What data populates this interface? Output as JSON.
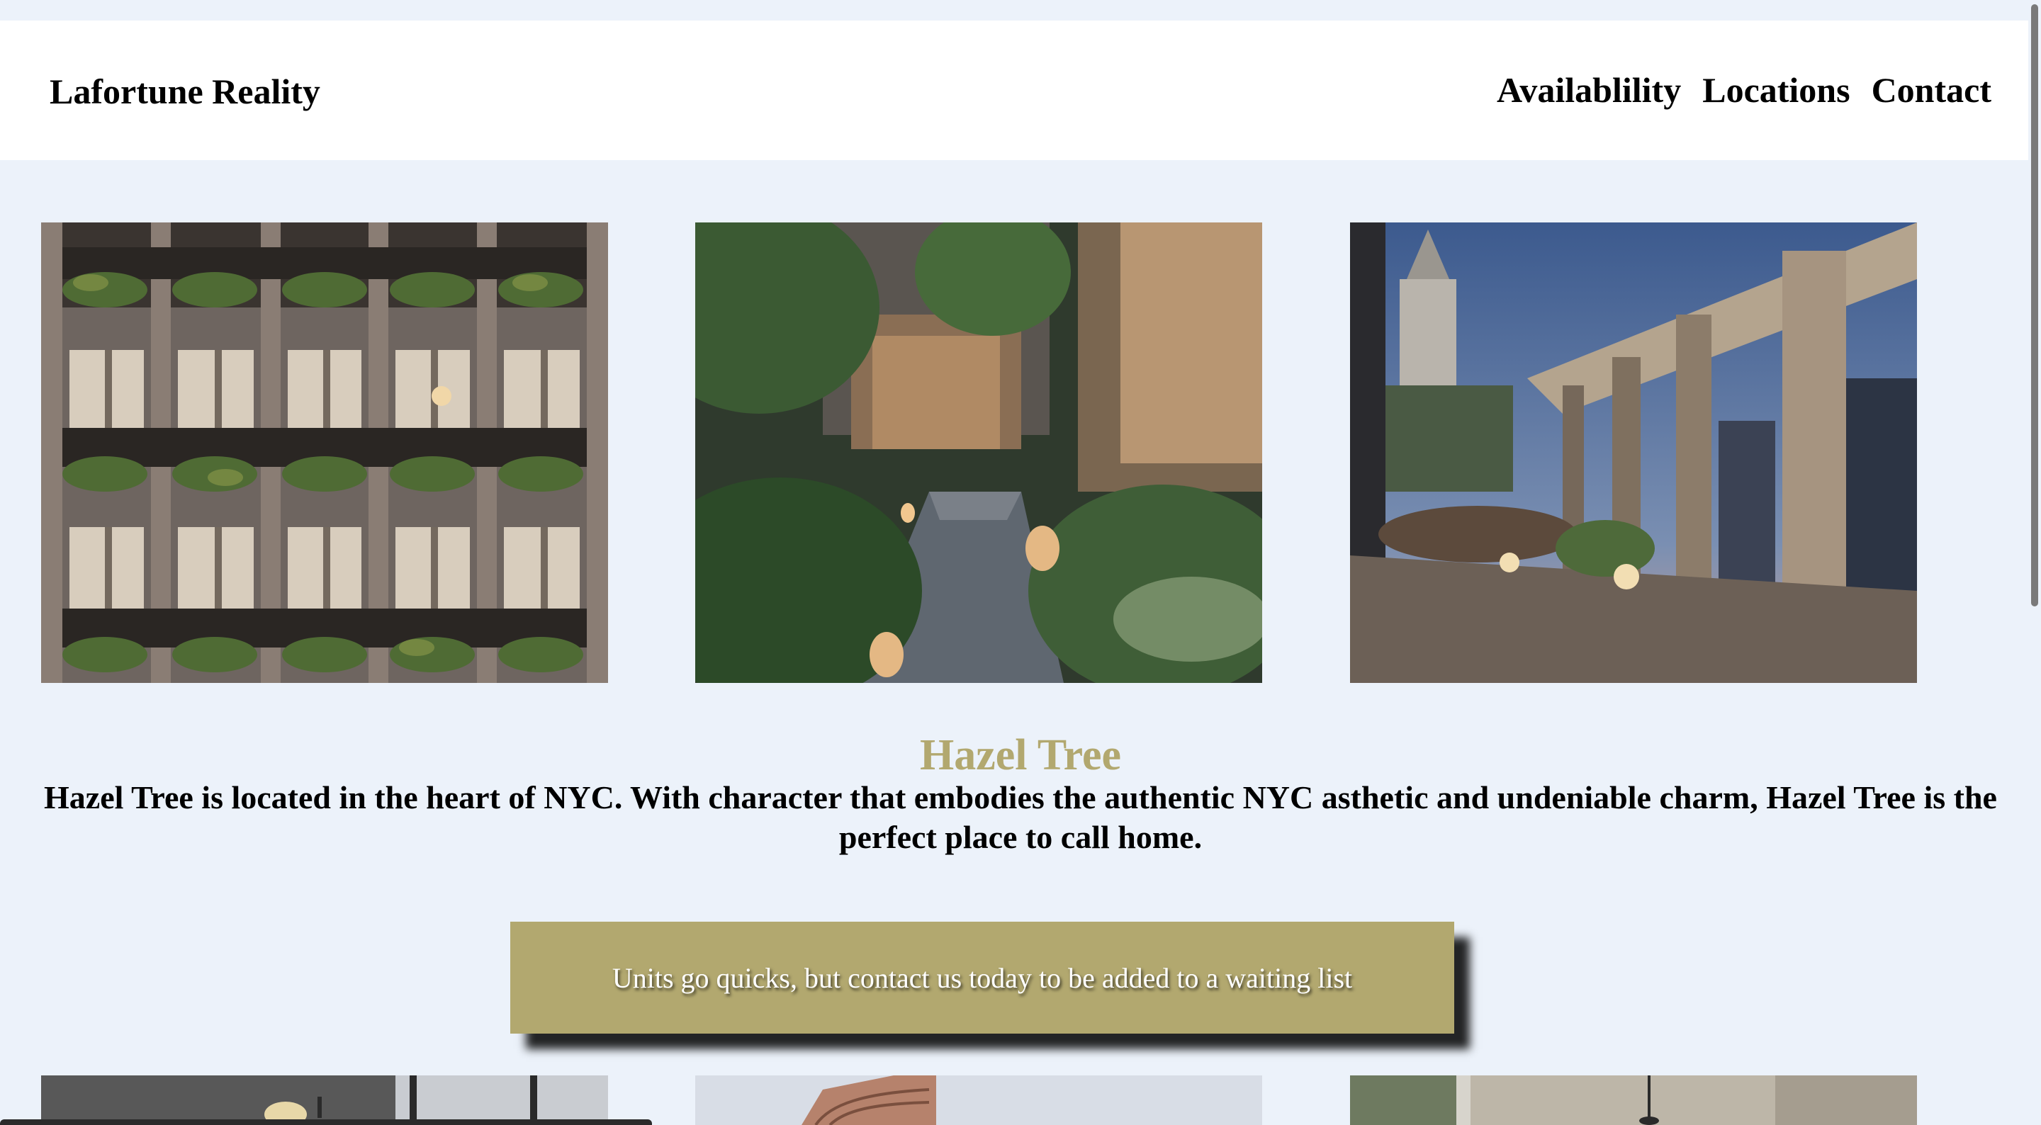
{
  "header": {
    "brand": "Lafortune Reality",
    "nav": [
      "Availablility",
      "Locations",
      "Contact"
    ]
  },
  "gallery": {
    "top_row": [
      "facade-balconies",
      "courtyard-garden",
      "rooftop-terrace"
    ],
    "bottom_row": [
      "interior-room",
      "brick-building",
      "interior-lobby"
    ]
  },
  "main": {
    "title": "Hazel Tree",
    "description": "Hazel Tree is located in the heart of NYC. With character that embodies the authentic NYC asthetic and undeniable charm, Hazel Tree is the perfect place to call home.",
    "cta_label": "Units go quicks, but contact us today to be added to a waiting list"
  },
  "colors": {
    "page_background": "#ecf2fa",
    "header_background": "#ffffff",
    "accent": "#b2a86f"
  }
}
